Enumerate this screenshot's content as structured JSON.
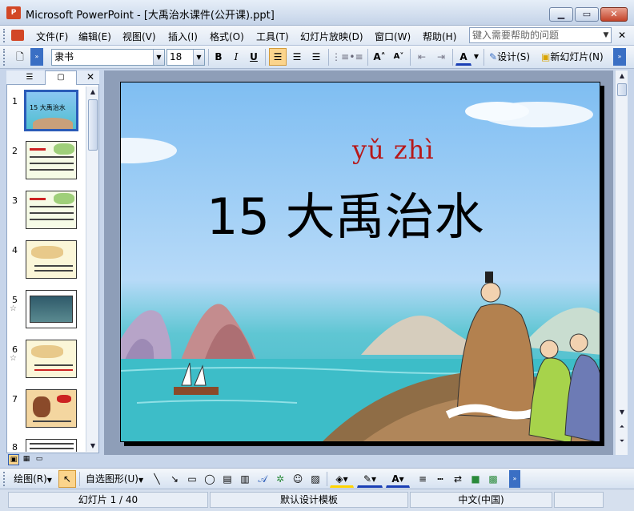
{
  "window": {
    "title": "Microsoft PowerPoint - [大禹治水课件(公开课).ppt]",
    "app_icon": "P"
  },
  "menu": {
    "items": [
      "文件(F)",
      "编辑(E)",
      "视图(V)",
      "插入(I)",
      "格式(O)",
      "工具(T)",
      "幻灯片放映(D)",
      "窗口(W)",
      "帮助(H)"
    ],
    "help_placeholder": "键入需要帮助的问题"
  },
  "toolbar": {
    "font_name": "隶书",
    "font_size": "18",
    "bold": "B",
    "italic": "I",
    "underline": "U",
    "design_label": "设计(S)",
    "new_slide_label": "新幻灯片(N)",
    "font_color_glyph": "A"
  },
  "slide_panel": {
    "slides": [
      {
        "num": "1",
        "star": ""
      },
      {
        "num": "2",
        "star": ""
      },
      {
        "num": "3",
        "star": ""
      },
      {
        "num": "4",
        "star": ""
      },
      {
        "num": "5",
        "star": "☆"
      },
      {
        "num": "6",
        "star": "☆"
      },
      {
        "num": "7",
        "star": ""
      },
      {
        "num": "8",
        "star": ""
      }
    ],
    "thumb1_title": "15 大禹治水"
  },
  "slide": {
    "pinyin": "yǔ  zhì",
    "title": "15  大禹治水"
  },
  "drawing_toolbar": {
    "draw_label": "绘图(R)",
    "autoshape_label": "自选图形(U)"
  },
  "status": {
    "slide_info": "幻灯片 1 / 40",
    "template": "默认设计模板",
    "language": "中文(中国)"
  },
  "colors": {
    "accent": "#d24726",
    "title_red": "#b7191a",
    "sky": "#7fbef2",
    "sea": "#3fb6c6"
  }
}
